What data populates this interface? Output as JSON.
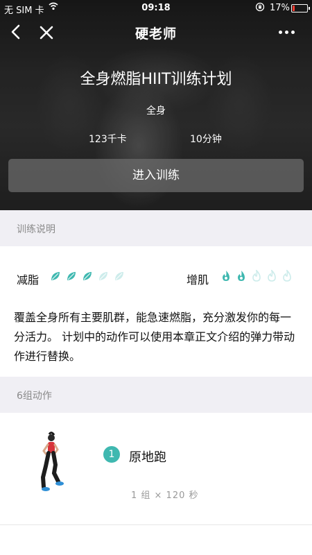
{
  "status_bar": {
    "carrier": "无 SIM 卡",
    "time": "09:18",
    "battery_pct": "17%",
    "battery_level": 0.17,
    "battery_color": "#ff3b30"
  },
  "navbar": {
    "title": "硬老师",
    "back_icon": "chevron-left-icon",
    "close_icon": "close-icon",
    "more_icon": "more-dots-icon"
  },
  "plan": {
    "title": "全身燃脂HIIT训练计划",
    "body_area": "全身",
    "calories": "123千卡",
    "duration": "10分钟",
    "start_button": "进入训练"
  },
  "description_section": {
    "header": "训练说明",
    "fat_loss_label": "减脂",
    "fat_loss_rating": 3,
    "fat_loss_max": 5,
    "muscle_gain_label": "增肌",
    "muscle_gain_rating": 2,
    "muscle_gain_max": 5,
    "accent_color": "#3fb8b0",
    "inactive_color": "#cdeceb",
    "text": "覆盖全身所有主要肌群，能急速燃脂，充分激发你的每一分活力。 计划中的动作可以使用本章正文介绍的弹力带动作进行替换。"
  },
  "actions_section": {
    "header": "6组动作",
    "items": [
      {
        "number": "1",
        "name": "原地跑",
        "detail": "1 组 × 120 秒"
      }
    ]
  }
}
